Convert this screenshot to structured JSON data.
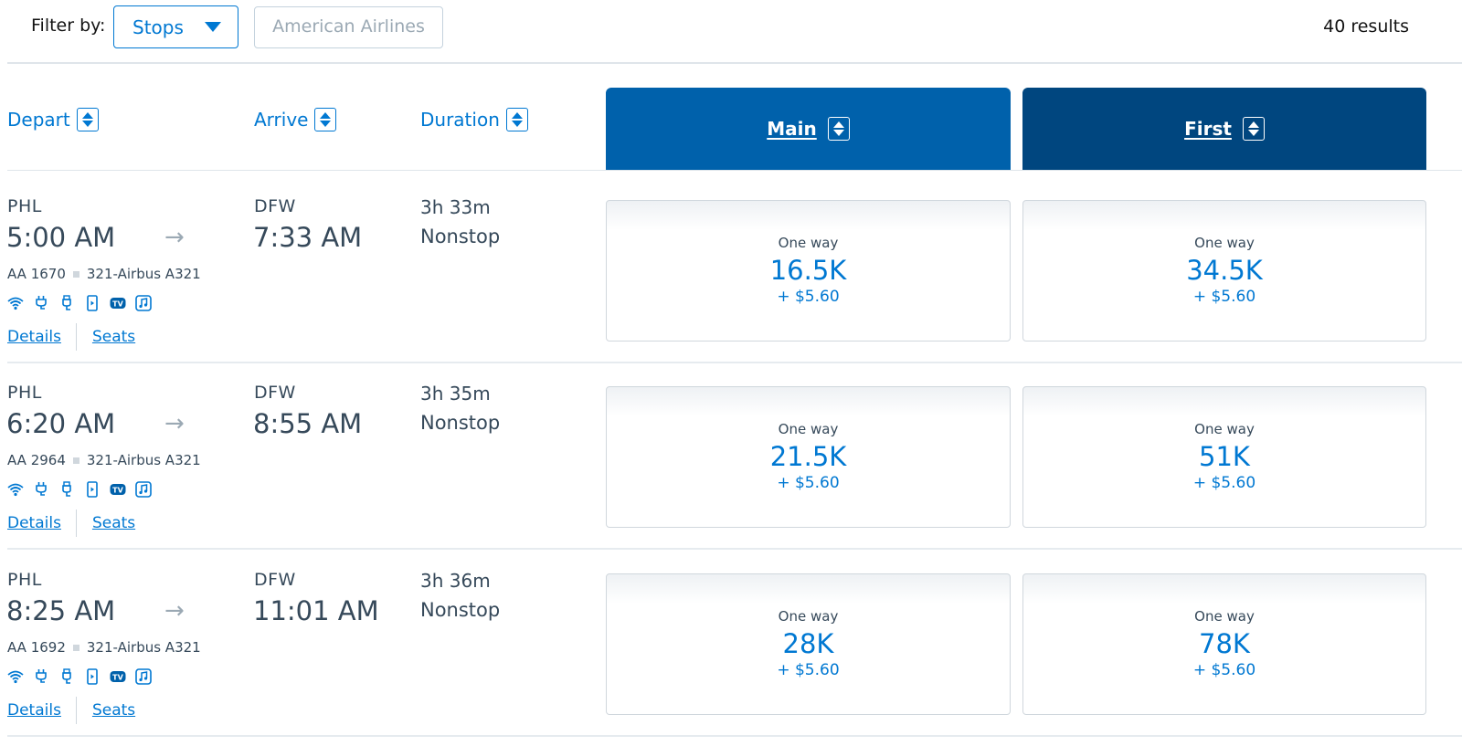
{
  "filter": {
    "label": "Filter by:",
    "stops_select": {
      "value": "Stops"
    },
    "airline_button": "American Airlines",
    "results_count": "40 results"
  },
  "columns": {
    "depart": "Depart",
    "arrive": "Arrive",
    "duration": "Duration",
    "main": "Main",
    "first": "First"
  },
  "colors": {
    "accent": "#0078d2",
    "main_header": "#0061ab",
    "first_header": "#00467f"
  },
  "flights": [
    {
      "origin": "PHL",
      "depart_time": "5:00 AM",
      "destination": "DFW",
      "arrive_time": "7:33 AM",
      "duration": "3h 33m",
      "stops": "Nonstop",
      "flight_number": "AA 1670",
      "aircraft": "321-Airbus A321",
      "amenities": [
        "wifi-icon",
        "power-outlet-icon",
        "usb-icon",
        "streaming-device-icon",
        "tv-icon",
        "music-icon"
      ],
      "tv_label": "TV",
      "details_link": "Details",
      "seats_link": "Seats",
      "fares": {
        "main": {
          "type": "One way",
          "miles": "16.5K",
          "tax": "+ $5.60"
        },
        "first": {
          "type": "One way",
          "miles": "34.5K",
          "tax": "+ $5.60"
        }
      }
    },
    {
      "origin": "PHL",
      "depart_time": "6:20 AM",
      "destination": "DFW",
      "arrive_time": "8:55 AM",
      "duration": "3h 35m",
      "stops": "Nonstop",
      "flight_number": "AA 2964",
      "aircraft": "321-Airbus A321",
      "amenities": [
        "wifi-icon",
        "power-outlet-icon",
        "usb-icon",
        "streaming-device-icon",
        "tv-icon",
        "music-icon"
      ],
      "tv_label": "TV",
      "details_link": "Details",
      "seats_link": "Seats",
      "fares": {
        "main": {
          "type": "One way",
          "miles": "21.5K",
          "tax": "+ $5.60"
        },
        "first": {
          "type": "One way",
          "miles": "51K",
          "tax": "+ $5.60"
        }
      }
    },
    {
      "origin": "PHL",
      "depart_time": "8:25 AM",
      "destination": "DFW",
      "arrive_time": "11:01 AM",
      "duration": "3h 36m",
      "stops": "Nonstop",
      "flight_number": "AA 1692",
      "aircraft": "321-Airbus A321",
      "amenities": [
        "wifi-icon",
        "power-outlet-icon",
        "usb-icon",
        "streaming-device-icon",
        "tv-icon",
        "music-icon"
      ],
      "tv_label": "TV",
      "details_link": "Details",
      "seats_link": "Seats",
      "fares": {
        "main": {
          "type": "One way",
          "miles": "28K",
          "tax": "+ $5.60"
        },
        "first": {
          "type": "One way",
          "miles": "78K",
          "tax": "+ $5.60"
        }
      }
    }
  ]
}
